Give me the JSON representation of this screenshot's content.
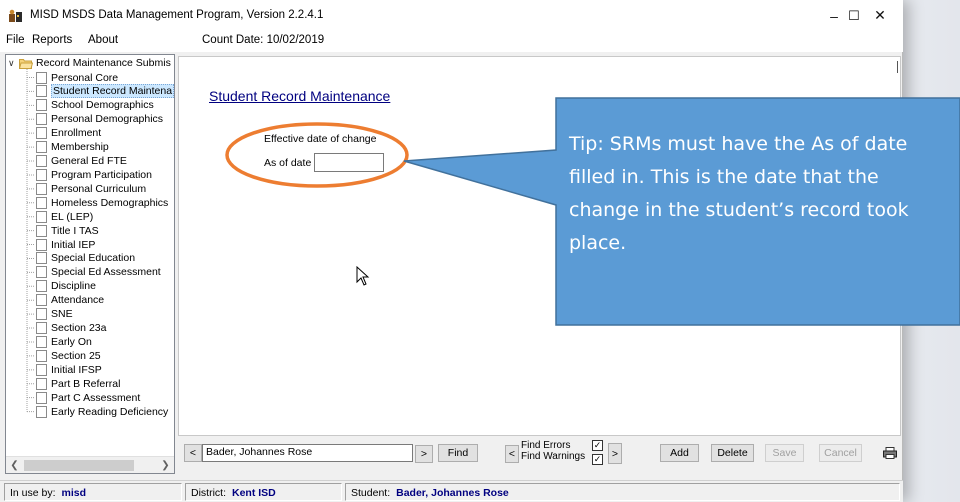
{
  "window": {
    "title": "MISD MSDS Data Management Program, Version 2.2.4.1",
    "controls": [
      "–",
      "☐",
      "✕"
    ]
  },
  "menu": {
    "items": [
      "File",
      "Reports",
      "About"
    ],
    "count_date": "Count Date: 10/02/2019"
  },
  "tree": {
    "root": "Record Maintenance Submis",
    "items": [
      {
        "label": "Personal Core"
      },
      {
        "label": "Student Record Maintena",
        "selected": true
      },
      {
        "label": "School Demographics"
      },
      {
        "label": "Personal Demographics"
      },
      {
        "label": "Enrollment"
      },
      {
        "label": "Membership"
      },
      {
        "label": "General Ed FTE"
      },
      {
        "label": "Program Participation"
      },
      {
        "label": "Personal Curriculum"
      },
      {
        "label": "Homeless Demographics"
      },
      {
        "label": "EL (LEP)"
      },
      {
        "label": "Title I TAS"
      },
      {
        "label": "Initial IEP"
      },
      {
        "label": "Special Education"
      },
      {
        "label": "Special Ed Assessment"
      },
      {
        "label": "Discipline"
      },
      {
        "label": "Attendance"
      },
      {
        "label": "SNE"
      },
      {
        "label": "Section 23a"
      },
      {
        "label": "Early On"
      },
      {
        "label": "Section 25"
      },
      {
        "label": "Initial IFSP"
      },
      {
        "label": "Part B Referral"
      },
      {
        "label": "Part C Assessment"
      },
      {
        "label": "Early Reading Deficiency"
      }
    ]
  },
  "form": {
    "title": "Student Record Maintenance",
    "effective_label": "Effective date of change",
    "asof_label": "As of date",
    "asof_value": ""
  },
  "callout": {
    "text": "Tip:  SRMs must have the As of date filled in.  This is the date that the change in the student’s record took place.",
    "fill": "#5b9bd5",
    "ring": "#ed7d31"
  },
  "bottom": {
    "prev": "<",
    "student": "Bader, Johannes Rose",
    "next": ">",
    "find": "Find",
    "err_prev": "<",
    "find_errors": "Find Errors",
    "find_warnings": "Find Warnings",
    "find_errors_checked": true,
    "find_warnings_checked": true,
    "err_next": ">",
    "add": "Add",
    "delete": "Delete",
    "save": "Save",
    "cancel": "Cancel",
    "check_mark": "✓"
  },
  "status": {
    "inuse_label": "In use by:",
    "inuse_value": "misd",
    "district_label": "District:",
    "district_value": "Kent ISD",
    "student_label": "Student:",
    "student_value": "Bader, Johannes Rose"
  }
}
